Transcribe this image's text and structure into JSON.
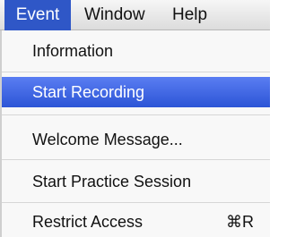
{
  "menubar": {
    "items": [
      {
        "label": "Event",
        "active": true
      },
      {
        "label": "Window",
        "active": false
      },
      {
        "label": "Help",
        "active": false
      }
    ]
  },
  "dropdown": {
    "items": [
      {
        "label": "Information",
        "highlighted": false
      },
      {
        "label": "Start Recording",
        "highlighted": true
      },
      {
        "label": "Welcome Message...",
        "highlighted": false
      },
      {
        "label": "Start Practice Session",
        "highlighted": false
      },
      {
        "label": "Restrict Access",
        "highlighted": false,
        "shortcut": "⌘R"
      }
    ]
  },
  "colors": {
    "menubar_active": "#2f57c7",
    "highlight": "#3a63e0",
    "menu_background": "#f8f8f8"
  }
}
